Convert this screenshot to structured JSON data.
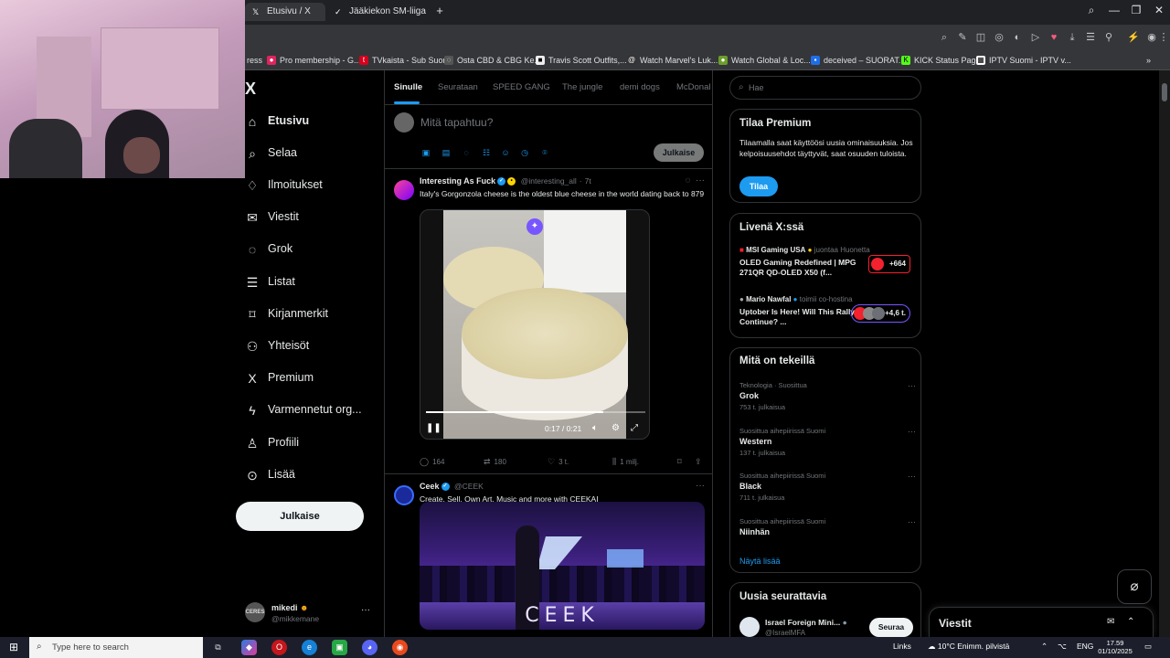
{
  "browser": {
    "tabs": [
      {
        "title": "Etusivu / X",
        "active": true,
        "icon": "x-icon"
      },
      {
        "title": "Jääkiekon SM-liiga – Liiga",
        "active": false,
        "icon": "liiga-icon"
      }
    ],
    "bookmarks": [
      "Pro membership - G...",
      "TVkaista - Sub Suora",
      "Osta CBD & CBG Ke...",
      "Travis Scott Outfits,...",
      "Watch Marvel's Luk...",
      "Watch Global & Loc...",
      "deceived – SUORAT...",
      "KICK Status Page",
      "IPTV Suomi - IPTV v..."
    ]
  },
  "nav": {
    "logo": "X",
    "items": [
      {
        "label": "Etusivu",
        "icon": "home-icon",
        "glyph": "⌂",
        "active": true
      },
      {
        "label": "Selaa",
        "icon": "search-icon",
        "glyph": "⌕"
      },
      {
        "label": "Ilmoitukset",
        "icon": "bell-icon",
        "glyph": "♢"
      },
      {
        "label": "Viestit",
        "icon": "mail-icon",
        "glyph": "✉"
      },
      {
        "label": "Grok",
        "icon": "grok-icon",
        "glyph": "◌"
      },
      {
        "label": "Listat",
        "icon": "list-icon",
        "glyph": "☰"
      },
      {
        "label": "Kirjanmerkit",
        "icon": "bookmark-icon",
        "glyph": "⌑"
      },
      {
        "label": "Yhteisöt",
        "icon": "communities-icon",
        "glyph": "⚇"
      },
      {
        "label": "Premium",
        "icon": "x-premium-icon",
        "glyph": "X"
      },
      {
        "label": "Varmennetut org...",
        "icon": "lightning-icon",
        "glyph": "ϟ"
      },
      {
        "label": "Profiili",
        "icon": "profile-icon",
        "glyph": "♙"
      },
      {
        "label": "Lisää",
        "icon": "more-circle-icon",
        "glyph": "⊙"
      }
    ],
    "post_button": "Julkaise",
    "account": {
      "name": "mikedi",
      "handle": "@mikkemane",
      "avatar_text": "CERES"
    }
  },
  "feed": {
    "tabs": [
      "Sinulle",
      "Seurataan",
      "SPEED GANG",
      "The jungle",
      "demi dogs",
      "McDonal"
    ],
    "composer": {
      "placeholder": "Mitä tapahtuu?",
      "button": "Julkaise"
    },
    "tweets": [
      {
        "name": "Interesting As Fuck",
        "handle": "@interesting_all",
        "time": "7t",
        "text": "Italy's Gorgonzola cheese is the oldest blue cheese in the world dating back to 879",
        "video": {
          "time": "0:17 / 0:21",
          "progress": 0.81
        },
        "replies": "164",
        "reposts": "180",
        "likes": "3 t.",
        "views": "1 milj."
      },
      {
        "name": "Ceek",
        "handle": "@CEEK",
        "text": "Create. Sell. Own Art, Music and more with CEEKAI",
        "media_brand": "CEEK"
      }
    ]
  },
  "sidebar": {
    "search_placeholder": "Hae",
    "premium": {
      "title": "Tilaa Premium",
      "text": "Tilaamalla saat käyttöösi uusia ominaisuuksia. Jos kelpoisuusehdot täyttyvät, saat osuuden tuloista.",
      "button": "Tilaa"
    },
    "live": {
      "title": "Livenä X:ssä",
      "items": [
        {
          "host": "MSI Gaming USA",
          "role": "juontaa Huonetta",
          "title": "OLED Gaming Redefined | MPG 271QR QD-OLED X50 (f...",
          "count": "+664"
        },
        {
          "host": "Mario Nawfal",
          "role": "toimii co-hostina",
          "title": "Uptober Is Here! Will This Rally Continue? ...",
          "count": "+4,6 t."
        }
      ]
    },
    "trends": {
      "title": "Mitä on tekeillä",
      "items": [
        {
          "category": "Teknologia · Suosittua",
          "name": "Grok",
          "count": "753 t. julkaisua"
        },
        {
          "category": "Suosittua aihepiirissä Suomi",
          "name": "Western",
          "count": "137 t. julkaisua"
        },
        {
          "category": "Suosittua aihepiirissä Suomi",
          "name": "Black",
          "count": "711 t. julkaisua"
        },
        {
          "category": "Suosittua aihepiirissä Suomi",
          "name": "Niinhän",
          "count": ""
        }
      ],
      "show_more": "Näytä lisää"
    },
    "who_to_follow": {
      "title": "Uusia seurattavia",
      "items": [
        {
          "name": "Israel Foreign Mini...",
          "handle": "@IsraelMFA",
          "button": "Seuraa"
        }
      ]
    }
  },
  "messages_drawer": {
    "title": "Viestit"
  },
  "taskbar": {
    "search_placeholder": "Type here to search",
    "links": "Links",
    "weather": "10°C  Enimm. pilvistä",
    "lang": "ENG",
    "time": "17.59",
    "date": "01/10/2025"
  }
}
